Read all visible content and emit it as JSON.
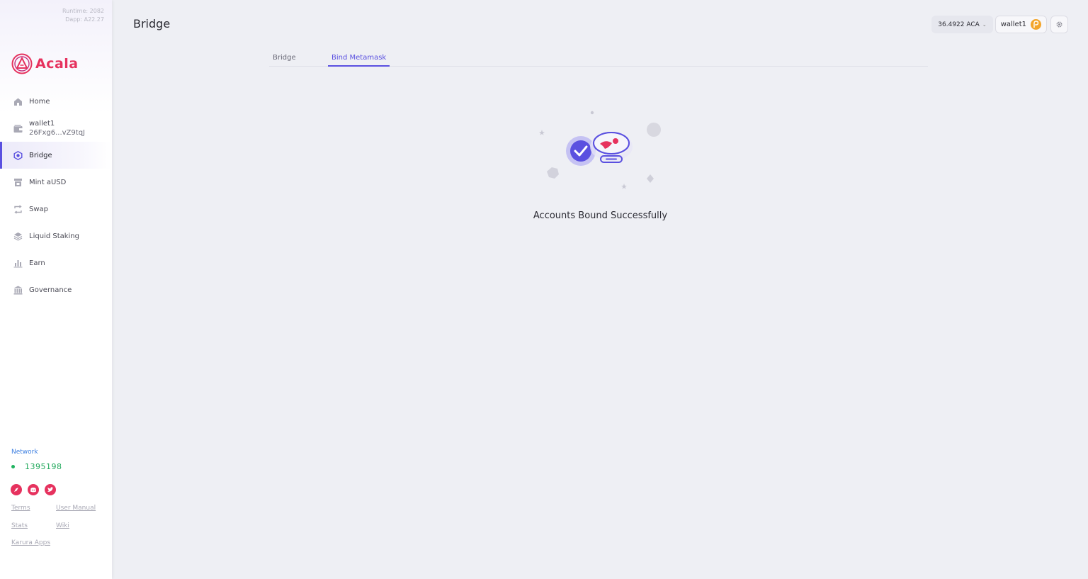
{
  "sidebar": {
    "version": {
      "runtime": "Runtime: 2082",
      "dapp": "Dapp: A22.27"
    },
    "logo_text": "Acala",
    "items": [
      {
        "label": "Home",
        "icon": "home-icon"
      },
      {
        "label": "wallet1",
        "sub": "26Fxg6...vZ9tqJ",
        "icon": "wallet-icon"
      },
      {
        "label": "Bridge",
        "icon": "bridge-icon",
        "active": true
      },
      {
        "label": "Mint aUSD",
        "icon": "mint-icon"
      },
      {
        "label": "Swap",
        "icon": "swap-icon"
      },
      {
        "label": "Liquid Staking",
        "icon": "staking-icon"
      },
      {
        "label": "Earn",
        "icon": "earn-icon"
      },
      {
        "label": "Governance",
        "icon": "governance-icon"
      }
    ],
    "network": {
      "label": "Network",
      "block": "1395198",
      "status_color": "#1fb35f"
    },
    "socials": [
      "compass-icon",
      "discord-icon",
      "twitter-icon"
    ],
    "links": {
      "terms": "Terms",
      "manual": "User Manual",
      "stats": "Stats",
      "wiki": "Wiki",
      "karura": "Karura Apps"
    }
  },
  "header": {
    "title": "Bridge",
    "balance": "36.4922 ACA",
    "wallet": "wallet1"
  },
  "tabs": [
    {
      "label": "Bridge",
      "active": false
    },
    {
      "label": "Bind Metamask",
      "active": true
    }
  ],
  "main": {
    "message": "Accounts Bound Successfully"
  },
  "colors": {
    "accent": "#5a50e0",
    "brand": "#e6325e",
    "network": "#1fa85a"
  }
}
